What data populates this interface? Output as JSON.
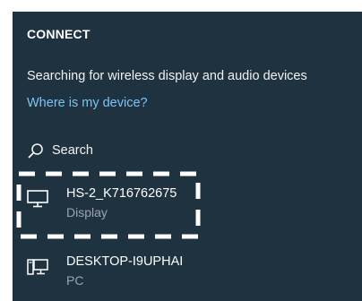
{
  "panel": {
    "title": "CONNECT",
    "status": "Searching for wireless display and audio devices",
    "help_link": "Where is my device?",
    "search_label": "Search"
  },
  "devices": [
    {
      "name": "HS-2_K716762675",
      "type": "Display",
      "icon": "monitor-icon"
    },
    {
      "name": "DESKTOP-I9UPHAI",
      "type": "PC",
      "icon": "pc-icon"
    }
  ],
  "colors": {
    "panel_bg": "#1f3240",
    "text": "#ffffff",
    "link": "#7cc4f5",
    "secondary_text": "#9aa6ae",
    "highlight_border": "#ffffff"
  }
}
